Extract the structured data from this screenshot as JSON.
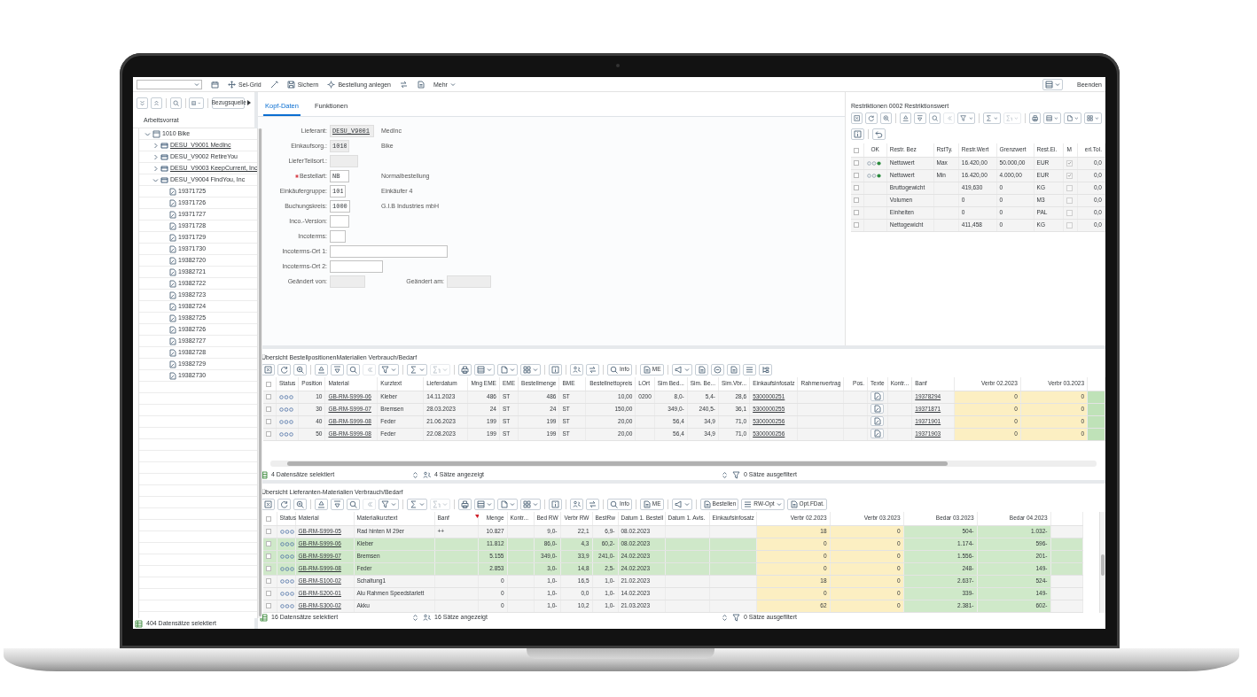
{
  "app_bar": {
    "items": [
      {
        "kind": "field"
      },
      {
        "kind": "icon"
      },
      {
        "kind": "icon",
        "label": "Sel-Grid"
      },
      {
        "kind": "icon"
      },
      {
        "kind": "icon",
        "label": "Sichern"
      },
      {
        "kind": "icon",
        "label": "Bestellung anlegen"
      },
      {
        "kind": "icon"
      },
      {
        "kind": "icon"
      },
      {
        "kind": "menu",
        "label": "Mehr"
      }
    ],
    "right_items": [
      {
        "kind": "menu-icon"
      },
      {
        "kind": "text",
        "label": "Beenden"
      }
    ]
  },
  "worklist": {
    "toolbar": [
      {
        "dropdown": false,
        "disabled": false
      },
      {
        "dropdown": false,
        "disabled": false
      },
      {
        "dropdown": false,
        "disabled": false
      },
      {
        "dropdown": true,
        "disabled": false
      },
      {
        "label": "Bezugsquelle",
        "dropdown": false,
        "disabled": false
      }
    ],
    "toolbar_overflow": true,
    "title": "Arbeitsvorrat",
    "tree": [
      {
        "label": "1010 Bike",
        "expanded": true,
        "underlined": false,
        "children": [
          {
            "label": "DESU_V9001 MedInc",
            "expanded": false,
            "underlined": true
          },
          {
            "label": "DESU_V9002 RetireYou",
            "expanded": false,
            "underlined": false
          },
          {
            "label": "DESU_V9003 KeepCurrent, Inc",
            "expanded": false,
            "underlined": true
          },
          {
            "label": "DESU_V9004 FindYou, Inc",
            "expanded": true,
            "underlined": false,
            "children": [
              {
                "label": "19371725",
                "underlined": false
              },
              {
                "label": "19371726",
                "underlined": false
              },
              {
                "label": "19371727",
                "underlined": false
              },
              {
                "label": "19371728",
                "underlined": false
              },
              {
                "label": "19371729",
                "underlined": false
              },
              {
                "label": "19371730",
                "underlined": false
              },
              {
                "label": "19382720",
                "underlined": false
              },
              {
                "label": "19382721",
                "underlined": false
              },
              {
                "label": "19382722",
                "underlined": false
              },
              {
                "label": "19382723",
                "underlined": false
              },
              {
                "label": "19382724",
                "underlined": false
              },
              {
                "label": "19382725",
                "underlined": false
              },
              {
                "label": "19382726",
                "underlined": false
              },
              {
                "label": "19382727",
                "underlined": false
              },
              {
                "label": "19382728",
                "underlined": false
              },
              {
                "label": "19382729",
                "underlined": false
              },
              {
                "label": "19382730",
                "underlined": false
              }
            ]
          }
        ]
      }
    ],
    "status": "404 Datensätze selektiert"
  },
  "header_tabs": [
    {
      "label": "Kopf-Daten",
      "selected": true
    },
    {
      "label": "Funktionen",
      "selected": false
    }
  ],
  "header_form": [
    {
      "label": "Lieferant:",
      "value": "DESU_V9001",
      "readonly": true,
      "link": true,
      "required": false,
      "description": "MedInc"
    },
    {
      "label": "Einkaufsorg.:",
      "value": "1010",
      "readonly": true,
      "link": false,
      "required": false,
      "description": "Bike"
    },
    {
      "label": "LieferTeilsort.:",
      "readonly": true,
      "required": false
    },
    {
      "label": "Bestellart:",
      "value": "NB",
      "readonly": false,
      "link": false,
      "required": true,
      "description": "Normalbestellung"
    },
    {
      "label": "Einkäufergruppe:",
      "value": "101",
      "readonly": false,
      "link": false,
      "required": false,
      "description": "Einkäufer 4"
    },
    {
      "label": "Buchungskreis:",
      "value": "1000",
      "readonly": false,
      "link": false,
      "required": false,
      "description": "G.I.B Industries mbH"
    },
    {
      "label": "Inco.-Version:",
      "readonly": false,
      "required": false
    },
    {
      "label": "Incoterms:",
      "readonly": false,
      "required": false
    },
    {
      "label": "Incoterms-Ort 1:",
      "readonly": false,
      "required": false
    },
    {
      "label": "Incoterms-Ort 2:",
      "readonly": false,
      "required": false
    },
    {
      "label": "Geändert von:",
      "readonly": true,
      "required": false,
      "extra": {
        "label": "Geändert am:",
        "readonly": true
      }
    }
  ],
  "restrictions": {
    "title": "Restriktionen 0002 Restriktionswert",
    "toolbar": [
      {
        "dropdown": false,
        "disabled": false
      },
      {
        "dropdown": false,
        "disabled": false
      },
      {
        "dropdown": false,
        "disabled": false
      },
      {
        "dropdown": false,
        "disabled": false
      },
      {
        "dropdown": false,
        "disabled": false
      },
      {
        "dropdown": false,
        "disabled": false
      },
      {
        "dropdown": false,
        "disabled": true
      },
      {
        "dropdown": true,
        "disabled": false
      },
      {
        "dropdown": true,
        "disabled": false
      },
      {
        "dropdown": true,
        "disabled": true
      },
      {
        "dropdown": false,
        "disabled": false
      },
      {
        "dropdown": true,
        "disabled": false
      },
      {
        "dropdown": true,
        "disabled": false
      },
      {
        "dropdown": true,
        "disabled": false
      }
    ],
    "toolbar2": [
      {
        "dropdown": false,
        "disabled": false
      },
      {
        "dropdown": false,
        "disabled": false
      }
    ],
    "columns": [
      {
        "label": "OK",
        "kind": "status"
      },
      {
        "label": "Restr. Bez",
        "kind": "text"
      },
      {
        "label": "RstTy.",
        "kind": "text"
      },
      {
        "label": "Restr.Wert",
        "kind": "text"
      },
      {
        "label": "Grenzwert",
        "kind": "text"
      },
      {
        "label": "Rest.Ei.",
        "kind": "text"
      },
      {
        "label": "M",
        "kind": "check"
      },
      {
        "label": "erl.Tol.",
        "kind": "text"
      }
    ],
    "rows": [
      {
        "lit": true,
        "checked": true,
        "cells": [
          "",
          "Nettowert",
          "Max",
          "16.420,00",
          "50.000,00",
          "EUR",
          "",
          "0,0"
        ]
      },
      {
        "lit": true,
        "checked": true,
        "cells": [
          "",
          "Nettowert",
          "Min",
          "16.420,00",
          "4.000,00",
          "EUR",
          "",
          "0,0"
        ]
      },
      {
        "lit": false,
        "checked": false,
        "cells": [
          "",
          "Bruttogewicht",
          "",
          "419,630",
          "0",
          "KG",
          "",
          "0,0"
        ]
      },
      {
        "lit": false,
        "checked": false,
        "cells": [
          "",
          "Volumen",
          "",
          "0",
          "0",
          "M3",
          "",
          "0,0"
        ]
      },
      {
        "lit": false,
        "checked": false,
        "cells": [
          "",
          "Einheiten",
          "",
          "0",
          "0",
          "PAL",
          "",
          "0,0"
        ]
      },
      {
        "lit": false,
        "checked": false,
        "cells": [
          "",
          "Nettogewicht",
          "",
          "411,458",
          "0",
          "KG",
          "",
          "0,0"
        ]
      }
    ]
  },
  "positions": {
    "title": "Übersicht BestellpositionenMaterialien Verbrauch/Bedarf",
    "toolbar": [
      {
        "dropdown": false,
        "disabled": false
      },
      {
        "dropdown": false,
        "disabled": false
      },
      {
        "dropdown": false,
        "disabled": false
      },
      {
        "dropdown": false,
        "disabled": false
      },
      {
        "dropdown": false,
        "disabled": false
      },
      {
        "dropdown": false,
        "disabled": false
      },
      {
        "dropdown": false,
        "disabled": true
      },
      {
        "dropdown": true,
        "disabled": false
      },
      {
        "dropdown": true,
        "disabled": false
      },
      {
        "dropdown": true,
        "disabled": true
      },
      {
        "dropdown": false,
        "disabled": false
      },
      {
        "dropdown": true,
        "disabled": false
      },
      {
        "dropdown": true,
        "disabled": false
      },
      {
        "dropdown": true,
        "disabled": false
      },
      {
        "dropdown": false,
        "disabled": false
      },
      {
        "dropdown": false,
        "disabled": false
      },
      {
        "dropdown": false,
        "disabled": false
      },
      {
        "label": "Info",
        "dropdown": false,
        "disabled": false
      },
      {
        "label": "ME",
        "dropdown": false,
        "disabled": false
      },
      {
        "dropdown": true,
        "disabled": false
      },
      {
        "dropdown": false,
        "disabled": false
      },
      {
        "dropdown": false,
        "disabled": false
      },
      {
        "dropdown": false,
        "disabled": false
      },
      {
        "dropdown": false,
        "disabled": false
      },
      {
        "dropdown": false,
        "disabled": false
      }
    ],
    "columns": [
      {
        "label": "Status",
        "kind": "status"
      },
      {
        "label": "Position",
        "kind": "text"
      },
      {
        "label": "Material",
        "kind": "link"
      },
      {
        "label": "Kurztext",
        "kind": "text"
      },
      {
        "label": "Lieferdatum",
        "kind": "text"
      },
      {
        "label": "Mng EME",
        "kind": "text"
      },
      {
        "label": "EME",
        "kind": "text"
      },
      {
        "label": "Bestellmenge",
        "kind": "text"
      },
      {
        "label": "BME",
        "kind": "text"
      },
      {
        "label": "Bestellnettopreis",
        "kind": "text"
      },
      {
        "label": "LOrt",
        "kind": "text"
      },
      {
        "label": "Sim Bed...",
        "kind": "text"
      },
      {
        "label": "Sim. Be...",
        "kind": "text"
      },
      {
        "label": "Sim.Vbr...",
        "kind": "text"
      },
      {
        "label": "Einkaufsinfosatz",
        "kind": "link"
      },
      {
        "label": "Rahmenvertrag",
        "kind": "text"
      },
      {
        "label": "Pos.",
        "kind": "text"
      },
      {
        "label": "Texte",
        "kind": "icon"
      },
      {
        "label": "Kontr...",
        "kind": "text"
      },
      {
        "label": "Banf",
        "kind": "link"
      },
      {
        "label": "Verbr 02.2023",
        "kind": "text",
        "color": "#fcefc2"
      },
      {
        "label": "Verbr 03.2023",
        "kind": "text",
        "color": "#fcefc2"
      },
      {
        "kind": "text",
        "color": "#bfe2b8"
      }
    ],
    "rows": [
      {
        "lit": false,
        "cells": [
          "",
          "10",
          "GB-RM-S999-06",
          "Kleber",
          "14.11.2023",
          "486",
          "ST",
          "486",
          "ST",
          "10,00",
          "0200",
          "8,0-",
          "5,4-",
          "28,6",
          "5300000251",
          "",
          "",
          "",
          "",
          "19378294",
          "0",
          "0",
          ""
        ]
      },
      {
        "lit": false,
        "cells": [
          "",
          "30",
          "GB-RM-S999-07",
          "Bremsen",
          "28.03.2023",
          "24",
          "ST",
          "24",
          "ST",
          "150,00",
          "",
          "349,0-",
          "240,5-",
          "36,1",
          "5300000255",
          "",
          "",
          "",
          "",
          "19371871",
          "0",
          "0",
          ""
        ]
      },
      {
        "lit": false,
        "cells": [
          "",
          "40",
          "GB-RM-S999-08",
          "Feder",
          "21.06.2023",
          "199",
          "ST",
          "199",
          "ST",
          "20,00",
          "",
          "56,4",
          "34,9",
          "71,0",
          "5300000256",
          "",
          "",
          "",
          "",
          "19371901",
          "0",
          "0",
          ""
        ]
      },
      {
        "lit": false,
        "cells": [
          "",
          "50",
          "GB-RM-S999-08",
          "Feder",
          "22.08.2023",
          "199",
          "ST",
          "199",
          "ST",
          "20,00",
          "",
          "56,4",
          "34,9",
          "71,0",
          "5300000256",
          "",
          "",
          "",
          "",
          "19371903",
          "0",
          "0",
          ""
        ]
      }
    ],
    "status": [
      "4 Datensätze selektiert",
      "4 Sätze angezeigt",
      "0 Sätze ausgefiltert"
    ]
  },
  "vendor_materials": {
    "title": "Übersicht Lieferanten-Materialien Verbrauch/Bedarf",
    "toolbar": [
      {
        "dropdown": false,
        "disabled": false
      },
      {
        "dropdown": false,
        "disabled": false
      },
      {
        "dropdown": false,
        "disabled": false
      },
      {
        "dropdown": false,
        "disabled": false
      },
      {
        "dropdown": false,
        "disabled": false
      },
      {
        "dropdown": false,
        "disabled": false
      },
      {
        "dropdown": false,
        "disabled": true
      },
      {
        "dropdown": true,
        "disabled": false
      },
      {
        "dropdown": true,
        "disabled": false
      },
      {
        "dropdown": true,
        "disabled": true
      },
      {
        "dropdown": false,
        "disabled": false
      },
      {
        "dropdown": true,
        "disabled": false
      },
      {
        "dropdown": true,
        "disabled": false
      },
      {
        "dropdown": true,
        "disabled": false
      },
      {
        "dropdown": false,
        "disabled": false
      },
      {
        "dropdown": false,
        "disabled": false
      },
      {
        "dropdown": false,
        "disabled": false
      },
      {
        "label": "Info",
        "dropdown": false,
        "disabled": false
      },
      {
        "label": "ME",
        "dropdown": false,
        "disabled": false
      },
      {
        "dropdown": true,
        "disabled": false
      },
      {
        "label": "Bestellen",
        "dropdown": false,
        "disabled": false
      },
      {
        "label": "RW-Opt",
        "dropdown": true,
        "disabled": false
      },
      {
        "label": "Opt.FDat.",
        "dropdown": false,
        "disabled": false
      }
    ],
    "columns": [
      {
        "label": "Status",
        "kind": "status"
      },
      {
        "label": "Material",
        "kind": "link"
      },
      {
        "label": "Materialkurztext",
        "kind": "text"
      },
      {
        "label": "Banf",
        "kind": "text",
        "sorted": true
      },
      {
        "label": "Menge",
        "kind": "text"
      },
      {
        "label": "Kontr...",
        "kind": "text"
      },
      {
        "label": "Bed RW",
        "kind": "text"
      },
      {
        "label": "Verbr RW",
        "kind": "text"
      },
      {
        "label": "BestRw",
        "kind": "text"
      },
      {
        "label": "Datum 1. Bestell",
        "kind": "text"
      },
      {
        "label": "Datum 1. Avis.",
        "kind": "text"
      },
      {
        "label": "Einkaufsinfosatz",
        "kind": "text"
      },
      {
        "label": "Verbr 02.2023",
        "kind": "text",
        "color": "#fcefc2"
      },
      {
        "label": "Verbr 03.2023",
        "kind": "text",
        "color": "#fcefc2"
      },
      {
        "label": "Bedar 03.2023",
        "kind": "text",
        "color": "#cfe9c9"
      },
      {
        "label": "Bedar 04.2023",
        "kind": "text",
        "color": "#cfe9c9"
      }
    ],
    "rows": [
      {
        "lit": false,
        "highlighted": false,
        "cells": [
          "",
          "GB-RM-S999-05",
          "Rad hinten M 29er",
          "++",
          "10.827",
          "",
          "9,0-",
          "22,1",
          "6,9-",
          "08.02.2023",
          "",
          "",
          "18",
          "0",
          "504-",
          "1.032-"
        ]
      },
      {
        "lit": false,
        "highlighted": true,
        "cells": [
          "",
          "GB-RM-S999-06",
          "Kleber",
          "",
          "11.812",
          "",
          "86,0-",
          "4,3",
          "60,2-",
          "08.02.2023",
          "",
          "",
          "0",
          "0",
          "1.174-",
          "596-"
        ]
      },
      {
        "lit": false,
        "highlighted": true,
        "cells": [
          "",
          "GB-RM-S999-07",
          "Bremsen",
          "",
          "5.155",
          "",
          "349,0-",
          "33,9",
          "241,0-",
          "24.02.2023",
          "",
          "",
          "0",
          "0",
          "1.556-",
          "201-"
        ]
      },
      {
        "lit": false,
        "highlighted": true,
        "cells": [
          "",
          "GB-RM-S999-08",
          "Feder",
          "",
          "2.853",
          "",
          "3,0-",
          "14,8",
          "2,5-",
          "24.02.2023",
          "",
          "",
          "0",
          "0",
          "248-",
          "149-"
        ]
      },
      {
        "lit": false,
        "highlighted": false,
        "cells": [
          "",
          "GB-RM-S100-02",
          "Schaltung1",
          "",
          "0",
          "",
          "1,0-",
          "16,5",
          "1,0-",
          "21.02.2023",
          "",
          "",
          "18",
          "0",
          "2.637-",
          "524-"
        ]
      },
      {
        "lit": false,
        "highlighted": false,
        "cells": [
          "",
          "GB-RM-S200-01",
          "Alu Rahmen Speedstarlett",
          "",
          "0",
          "",
          "1,0-",
          "0,0",
          "1,0-",
          "14.02.2023",
          "",
          "",
          "0",
          "0",
          "339-",
          "149-"
        ]
      },
      {
        "lit": false,
        "highlighted": false,
        "cells": [
          "",
          "GB-RM-S300-02",
          "Akku",
          "",
          "0",
          "",
          "1,0-",
          "10,2",
          "1,0-",
          "21.03.2023",
          "",
          "",
          "62",
          "0",
          "2.381-",
          "602-"
        ]
      }
    ],
    "status": [
      "16 Datensätze selektiert",
      "16 Sätze angezeigt",
      "0 Sätze ausgefiltert"
    ]
  }
}
